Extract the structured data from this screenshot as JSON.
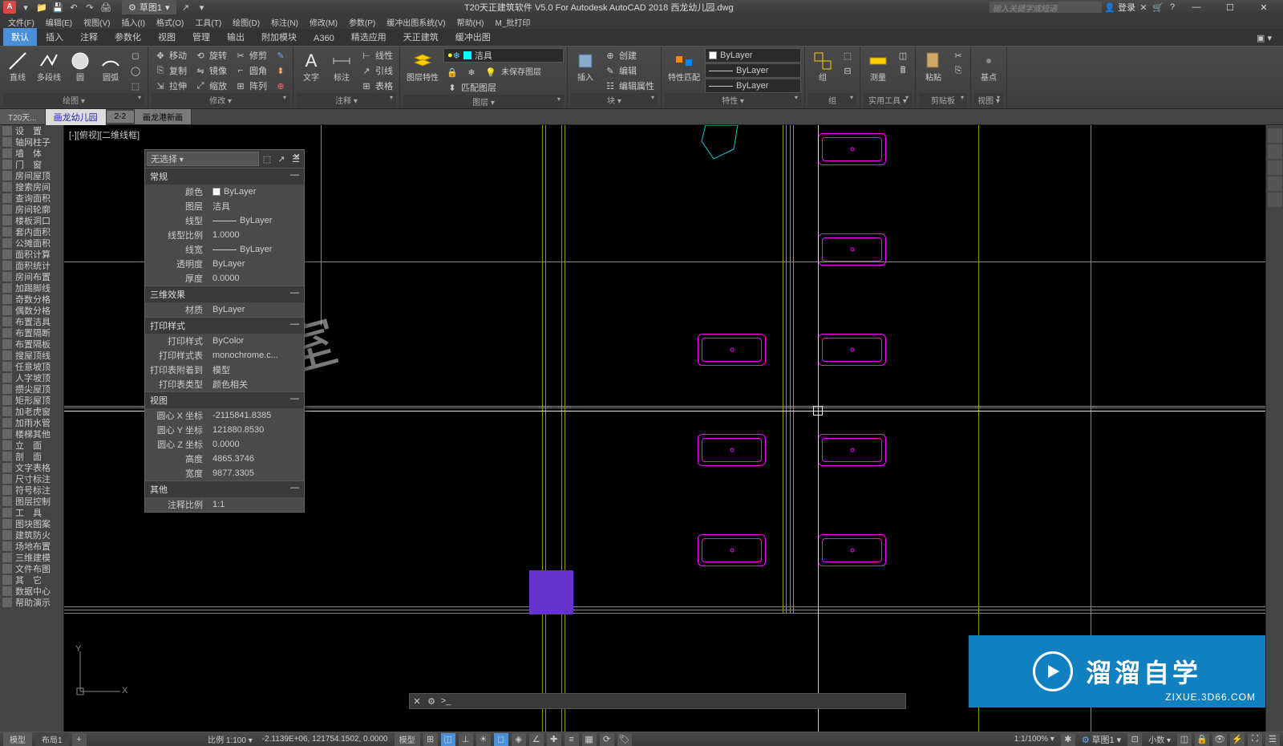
{
  "app_icon": "A",
  "qat_doc_name": "草图1",
  "window_title": "T20天正建筑软件 V5.0 For Autodesk AutoCAD 2018  西龙幼儿园.dwg",
  "search_placeholder": "输入关键字或短语",
  "login_label": "登录",
  "menus": [
    "文件(F)",
    "编辑(E)",
    "视图(V)",
    "插入(I)",
    "格式(O)",
    "工具(T)",
    "绘图(D)",
    "标注(N)",
    "修改(M)",
    "参数(P)",
    "缓冲出图系统(V)",
    "帮助(H)",
    "M_批打印"
  ],
  "ribbon_tabs": [
    "默认",
    "插入",
    "注释",
    "参数化",
    "视图",
    "管理",
    "输出",
    "附加模块",
    "A360",
    "精选应用",
    "天正建筑",
    "缓冲出图"
  ],
  "ribbon": {
    "draw": {
      "label": "绘图 ▾",
      "line": "直线",
      "pline": "多段线",
      "circle": "圆",
      "arc": "圆弧"
    },
    "modify": {
      "label": "修改 ▾",
      "move": "移动",
      "rotate": "旋转",
      "trim": "修剪",
      "copy": "复制",
      "mirror": "镜像",
      "fillet": "圆角",
      "stretch": "拉伸",
      "scale": "缩放",
      "array": "阵列"
    },
    "annot": {
      "label": "注释 ▾",
      "text": "文字",
      "dim": "标注",
      "table": "表格",
      "linetype": "线性",
      "leader": "引线"
    },
    "layers": {
      "label": "图层 ▾",
      "props": "图层特性",
      "current": "洁具",
      "btns": [
        "锁定",
        "冻结",
        "隐藏",
        "未保存图层",
        "匹配图层"
      ]
    },
    "block": {
      "label": "块 ▾",
      "insert": "插入",
      "create": "创建",
      "edit": "编辑",
      "editattr": "编辑属性"
    },
    "props": {
      "label": "特性 ▾",
      "match": "特性匹配",
      "bylayer": "ByLayer"
    },
    "group": {
      "label": "组",
      "btn": "组"
    },
    "util": {
      "label": "实用工具 ▾",
      "measure": "测量"
    },
    "clip": {
      "label": "剪贴板",
      "paste": "粘贴"
    },
    "view": {
      "label": "视图 ▾",
      "base": "基点"
    }
  },
  "file_tabs": [
    "T20天...",
    "画龙幼儿园",
    "2-2",
    "画龙港新画"
  ],
  "viewport_label": "[-][俯视][二维线框]",
  "left_tools": [
    "设　置",
    "轴网柱子",
    "墙　体",
    "门　窗",
    "房间屋顶",
    "搜索房间",
    "查询面积",
    "房间轮廓",
    "楼板洞口",
    "套内面积",
    "公摊面积",
    "面积计算",
    "面积统计",
    "房间布置",
    "加踢脚线",
    "奇数分格",
    "偶数分格",
    "布置洁具",
    "布置隔断",
    "布置隔板",
    "搜屋顶线",
    "任意坡顶",
    "人字坡顶",
    "攒尖屋顶",
    "矩形屋顶",
    "加老虎窗",
    "加雨水管",
    "楼梯其他",
    "立　面",
    "剖　面",
    "文字表格",
    "尺寸标注",
    "符号标注",
    "图层控制",
    "工　具",
    "图块图案",
    "建筑防火",
    "场地布置",
    "三维建模",
    "文件布图",
    "其　它",
    "数据中心",
    "帮助演示"
  ],
  "props": {
    "title": "无选择",
    "sections": {
      "general": "常规",
      "threed": "三维效果",
      "plot": "打印样式",
      "view": "视图",
      "misc": "其他"
    },
    "rows": {
      "color_k": "颜色",
      "color_v": "ByLayer",
      "layer_k": "图层",
      "layer_v": "洁具",
      "ltype_k": "线型",
      "ltype_v": "ByLayer",
      "ltscale_k": "线型比例",
      "ltscale_v": "1.0000",
      "lweight_k": "线宽",
      "lweight_v": "ByLayer",
      "transp_k": "透明度",
      "transp_v": "ByLayer",
      "thick_k": "厚度",
      "thick_v": "0.0000",
      "material_k": "材质",
      "material_v": "ByLayer",
      "pstyle_k": "打印样式",
      "pstyle_v": "ByColor",
      "pstab_k": "打印样式表",
      "pstab_v": "monochrome.c...",
      "psatt_k": "打印表附着到",
      "psatt_v": "模型",
      "pstype_k": "打印表类型",
      "pstype_v": "颜色相关",
      "cx_k": "圆心 X 坐标",
      "cx_v": "-2115841.8385",
      "cy_k": "圆心 Y 坐标",
      "cy_v": "121880.8530",
      "cz_k": "圆心 Z 坐标",
      "cz_v": "0.0000",
      "h_k": "高度",
      "h_v": "4865.3746",
      "w_k": "宽度",
      "w_v": "9877.3305",
      "annoscale_k": "注释比例",
      "annoscale_v": "1:1"
    }
  },
  "cmd_prompt": ">_",
  "drawing_text": "息室",
  "status": {
    "model_tab": "模型",
    "layout_tab": "布局1",
    "scale_label": "比例 1:100 ▾",
    "coords": "-2.1139E+06, 121754.1502, 0.0000",
    "mode": "模型",
    "ratio": "1:1/100% ▾",
    "layer_state": "草图1 ▾",
    "dec": "小数 ▾"
  },
  "watermark": {
    "text": "溜溜自学",
    "url": "ZIXUE.3D66.COM"
  }
}
